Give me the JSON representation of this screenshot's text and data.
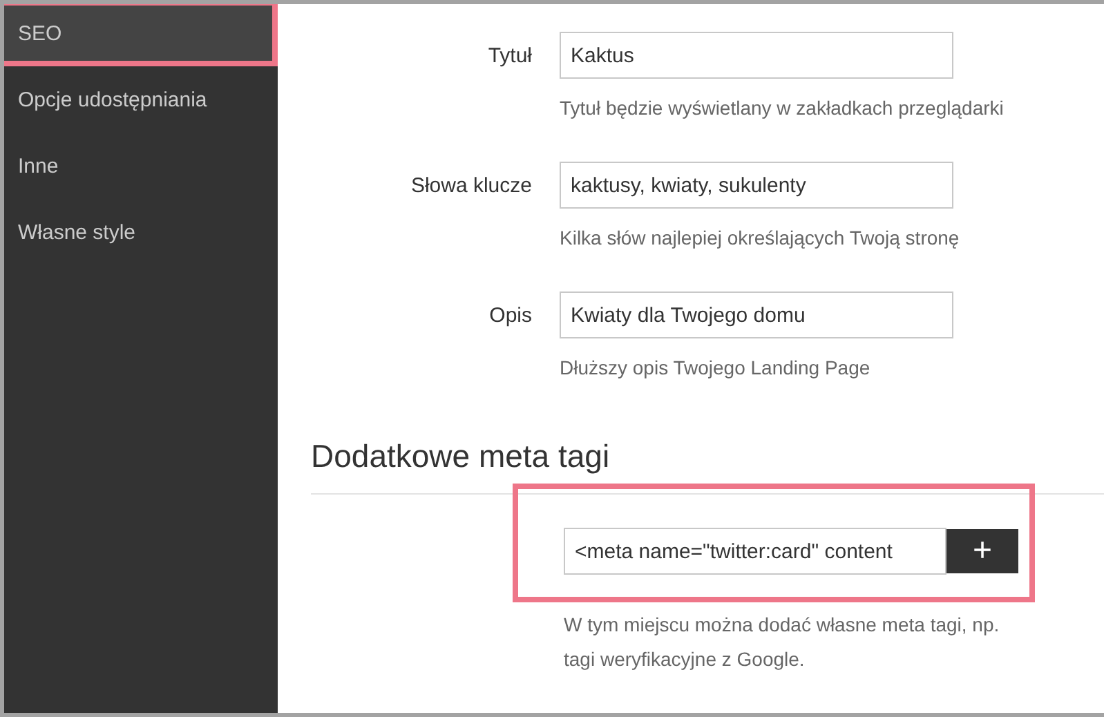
{
  "sidebar": {
    "items": [
      {
        "label": "SEO",
        "selected": true
      },
      {
        "label": "Opcje udostępniania",
        "selected": false
      },
      {
        "label": "Inne",
        "selected": false
      },
      {
        "label": "Własne style",
        "selected": false
      }
    ]
  },
  "fields": [
    {
      "label": "Tytuł",
      "value": "Kaktus",
      "hint": "Tytuł będzie wyświetlany w zakładkach przeglądarki"
    },
    {
      "label": "Słowa klucze",
      "value": "kaktusy, kwiaty, sukulenty",
      "hint": "Kilka słów najlepiej określających Twoją stronę"
    },
    {
      "label": "Opis",
      "value": "Kwiaty dla Twojego domu",
      "hint": "Dłuższy opis Twojego Landing Page"
    }
  ],
  "meta_tags": {
    "heading": "Dodatkowe meta tagi",
    "highlighted": true,
    "value": "<meta name=\"twitter:card\" content",
    "button": "+",
    "hint": "W tym miejscu można dodać własne meta tagi, np. tagi weryfikacyjne z Google."
  }
}
